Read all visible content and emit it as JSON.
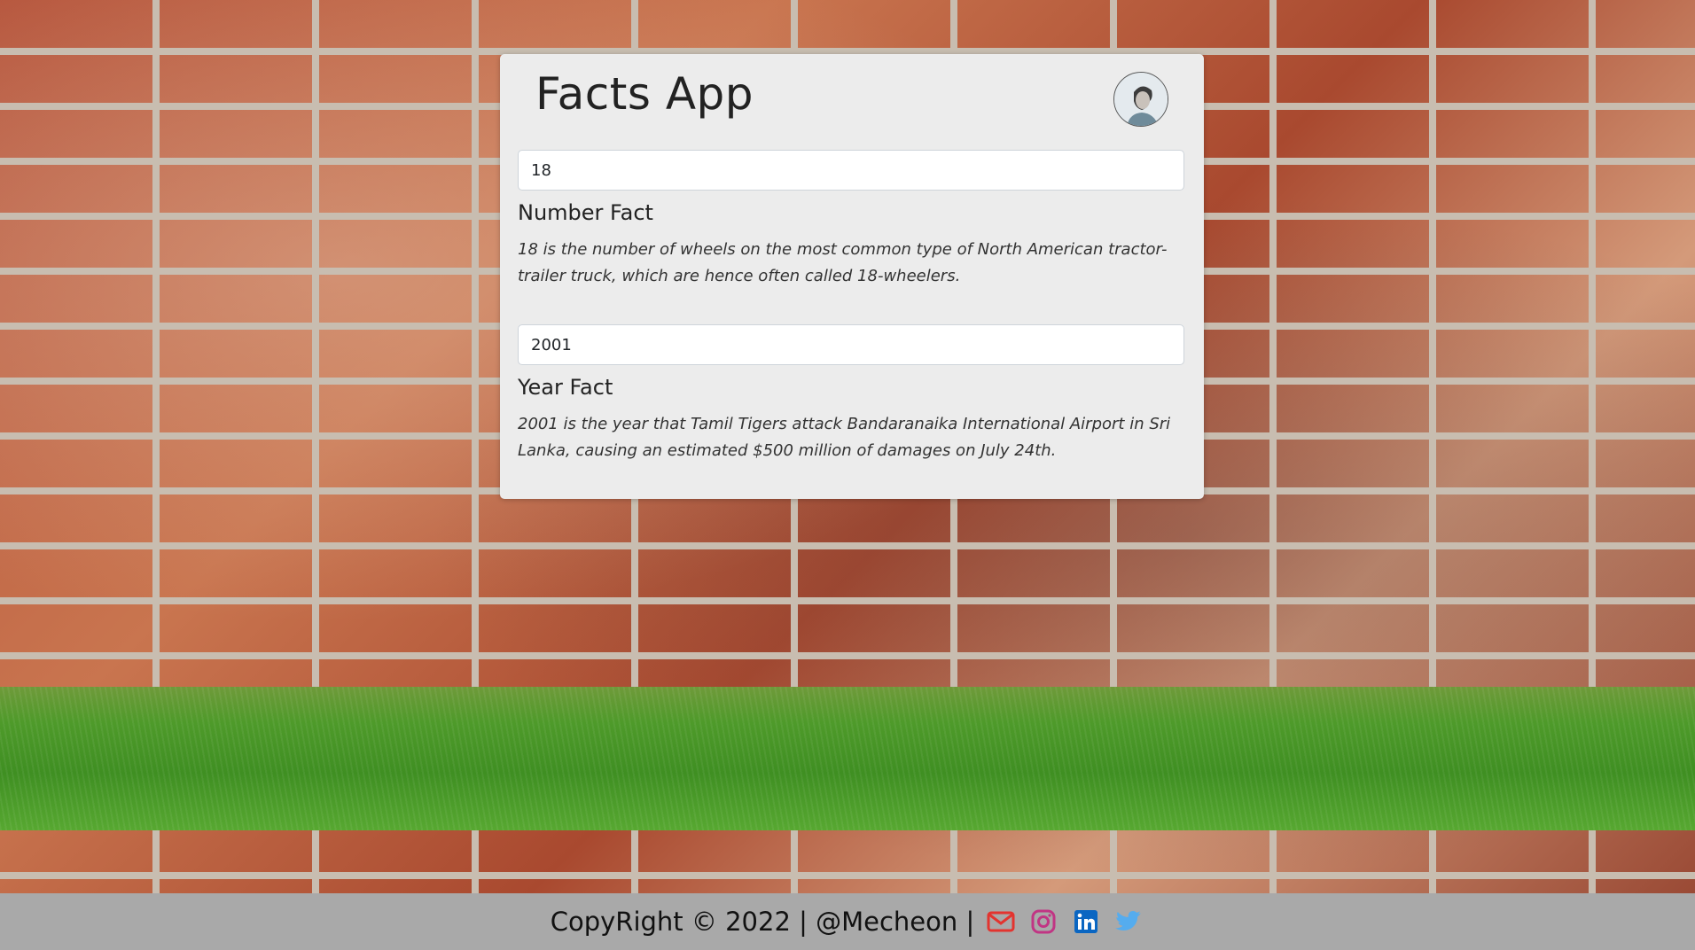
{
  "app": {
    "title": "Facts App"
  },
  "number_section": {
    "input_value": "18",
    "heading": "Number Fact",
    "fact": "18 is the number of wheels on the most common type of North American tractor-trailer truck, which are hence often called 18-wheelers."
  },
  "year_section": {
    "input_value": "2001",
    "heading": "Year Fact",
    "fact": "2001 is the year that Tamil Tigers attack Bandaranaika International Airport in Sri Lanka, causing an estimated $500 million of damages on July 24th."
  },
  "footer": {
    "copyright": "CopyRight © 2022 | @Mecheon |",
    "icons": [
      "mail-icon",
      "instagram-icon",
      "linkedin-icon",
      "twitter-icon"
    ]
  },
  "colors": {
    "mail": "#e3342f",
    "instagram": "#c13584",
    "linkedin": "#0a66c2",
    "twitter": "#55acee",
    "card_bg": "#ececec",
    "footer_bg": "#a9a9a9"
  }
}
